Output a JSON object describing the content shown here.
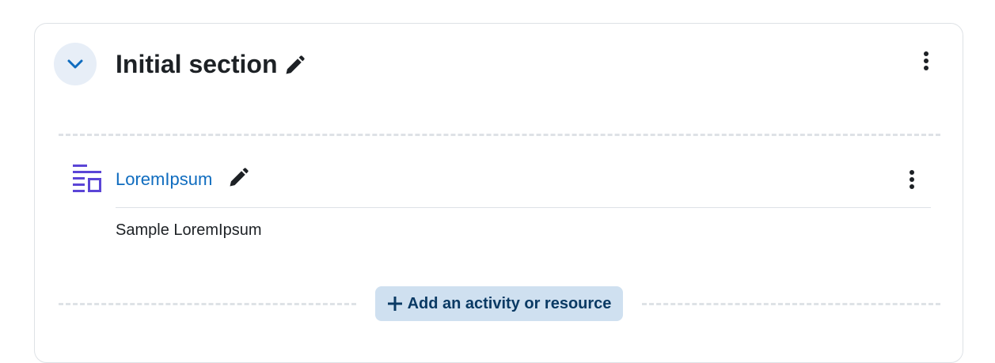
{
  "section": {
    "title": "Initial section",
    "collapse_icon": "chevron-down-icon",
    "edit_icon": "pencil-icon",
    "menu_icon": "kebab-menu-icon"
  },
  "activity": {
    "name": "LoremIpsum",
    "description": "Sample LoremIpsum",
    "icon": "page-icon",
    "edit_icon": "pencil-icon",
    "menu_icon": "kebab-menu-icon"
  },
  "add_activity": {
    "label": "Add an activity or resource",
    "icon": "plus-icon"
  },
  "colors": {
    "accent": "#0f6cbf",
    "activity_icon": "#5b45d6",
    "add_button_bg": "#cfe0f0",
    "add_button_text": "#0a3a64",
    "collapse_bg": "#e7eef7"
  }
}
